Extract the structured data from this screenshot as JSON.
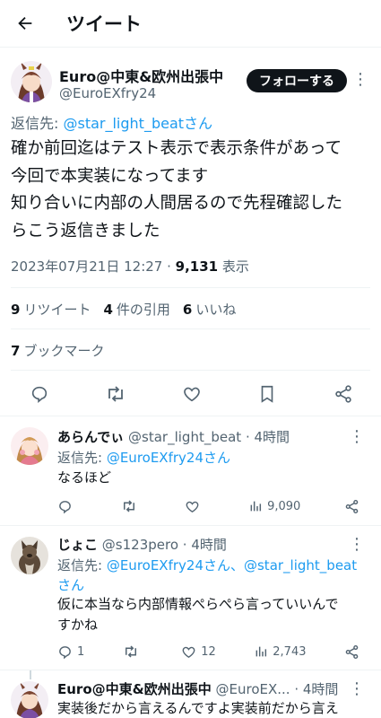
{
  "header": {
    "title": "ツイート",
    "back_icon": "arrow-left-icon"
  },
  "main_tweet": {
    "author_name": "Euro@中東&欧州出張中",
    "author_handle": "@EuroEXfry24",
    "follow_label": "フォローする",
    "reply_to_prefix": "返信先: ",
    "reply_to_user": "@star_light_beatさん",
    "text_lines": [
      "確か前回迄はテスト表示で表示条件があって",
      "今回で本実装になってます",
      "知り合いに内部の人間居るので先程確認した",
      "らこう返信きました"
    ],
    "timestamp": "2023年07月21日 12:27 ·",
    "views_count": "9,131",
    "views_label": "表示",
    "retweets_count": "9",
    "retweets_label": "リツイート",
    "quotes_count": "4",
    "quotes_label": "件の引用",
    "likes_count": "6",
    "likes_label": "いいね",
    "bookmarks_count": "7",
    "bookmarks_label": "ブックマーク"
  },
  "replies": [
    {
      "name": "あらんでぃ",
      "handle": "@star_light_beat",
      "time": "· 4時間",
      "reply_to_prefix": "返信先: ",
      "reply_to_user": "@EuroEXfry24さん",
      "text_lines": [
        "なるほど"
      ],
      "replies": "",
      "retweets": "",
      "likes": "",
      "views": "9,090"
    },
    {
      "name": "じょこ",
      "handle": "@s123pero",
      "time": "· 4時間",
      "reply_to_prefix": "返信先: ",
      "reply_to_user": "@EuroEXfry24さん、@star_light_beat",
      "reply_to_user_cont": "さん",
      "text_lines": [
        "仮に本当なら内部情報ぺらぺら言っていいんで",
        "すかね"
      ],
      "replies": "1",
      "retweets": "",
      "likes": "12",
      "views": "2,743"
    },
    {
      "name": "Euro@中東&欧州出張中",
      "handle": "@EuroEX...",
      "time": "· 4時間",
      "text_lines": [
        "実装後だから言えるんですよ実装前だから言え"
      ]
    }
  ],
  "colors": {
    "accent": "#1d9bf0",
    "text": "#0f1419",
    "muted": "#536471",
    "border": "#eff3f4"
  }
}
